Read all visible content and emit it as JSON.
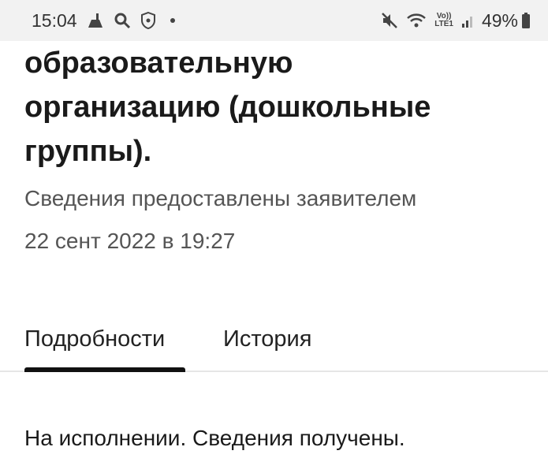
{
  "status_bar": {
    "time": "15:04",
    "left_icons": [
      "cleaning-icon",
      "search-icon",
      "shield-icon",
      "notification-dot"
    ],
    "right_icons": [
      "mute-icon",
      "wifi-icon",
      "volte-icon",
      "signal-icon",
      "battery-icon"
    ],
    "volte_top": "Vo))",
    "volte_bottom": "LTE1",
    "battery": "49%"
  },
  "header": {
    "title_lines": [
      "образовательную",
      "организацию (дошкольные",
      "группы)."
    ]
  },
  "meta": {
    "source": "Сведения предоставлены заявителем",
    "date": "22 сент 2022 в 19:27"
  },
  "tabs": [
    {
      "label": "Подробности",
      "active": true
    },
    {
      "label": "История",
      "active": false
    }
  ],
  "details": {
    "status": "На исполнении. Сведения получены."
  },
  "colors": {
    "status_bar_bg": "#f2f2f2",
    "text": "#1a1a1a",
    "secondary_text": "#555555",
    "tab_indicator": "#111111"
  }
}
